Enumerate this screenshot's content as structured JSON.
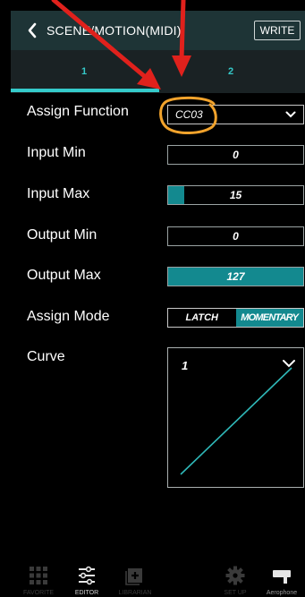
{
  "header": {
    "title": "SCENE/MOTION(MIDI)",
    "write_label": "WRITE"
  },
  "tabs": [
    {
      "label": "1",
      "selected": true
    },
    {
      "label": "2",
      "selected": false
    }
  ],
  "fields": {
    "assign_function": {
      "label": "Assign Function",
      "value": "CC03"
    },
    "input_min": {
      "label": "Input Min",
      "value": "0",
      "level": 0
    },
    "input_max": {
      "label": "Input Max",
      "value": "15",
      "level": 0.118
    },
    "output_min": {
      "label": "Output Min",
      "value": "0",
      "level": 0
    },
    "output_max": {
      "label": "Output Max",
      "value": "127",
      "level": 1.0
    },
    "assign_mode": {
      "label": "Assign Mode",
      "options": [
        "LATCH",
        "MOMENTARY"
      ],
      "selected": "MOMENTARY"
    },
    "curve": {
      "label": "Curve",
      "number": "1"
    }
  },
  "bottom_nav": [
    {
      "label": "FAVORITE",
      "icon": "grid-icon",
      "active": false
    },
    {
      "label": "EDITOR",
      "icon": "sliders-icon",
      "active": true
    },
    {
      "label": "LIBRARIAN",
      "icon": "plus-box-icon",
      "active": false
    },
    {
      "label": "SET UP",
      "icon": "gear-icon",
      "active": false
    },
    {
      "label": "Aerophone",
      "icon": "device-icon",
      "active": false
    }
  ],
  "colors": {
    "accent": "#35cbcb",
    "fill": "#13898f",
    "header_bg": "#1e3436",
    "tab_bg": "#1a2224",
    "annotation_arrow": "#e0211c",
    "annotation_ring": "#f2a32c"
  }
}
